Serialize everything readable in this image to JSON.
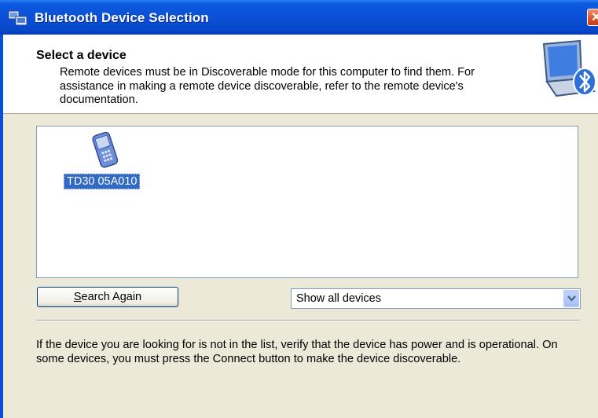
{
  "window": {
    "title": "Bluetooth Device Selection",
    "close_icon": "close-icon",
    "title_icon": "bluetooth-devices-icon"
  },
  "header": {
    "title": "Select a device",
    "description": "Remote devices must be in Discoverable mode for this computer to find them. For assistance in making a remote device discoverable, refer to the remote device's documentation.",
    "graphic_icon": "computer-bluetooth-icon"
  },
  "device_list": {
    "items": [
      {
        "label": "TD30  05A010",
        "icon": "pda-device-icon",
        "selected": true
      }
    ]
  },
  "controls": {
    "search_again_prefix": "S",
    "search_again_rest": "earch Again",
    "filter": {
      "selected": "Show all devices"
    }
  },
  "footer": {
    "text": "If the device you are looking for is not in the list, verify that the device has power and is operational. On some devices, you must press the Connect button to make the device discoverable."
  },
  "colors": {
    "titlebar": "#0b50d6",
    "selection": "#316ac5",
    "dialog_bg": "#ece9d8"
  }
}
